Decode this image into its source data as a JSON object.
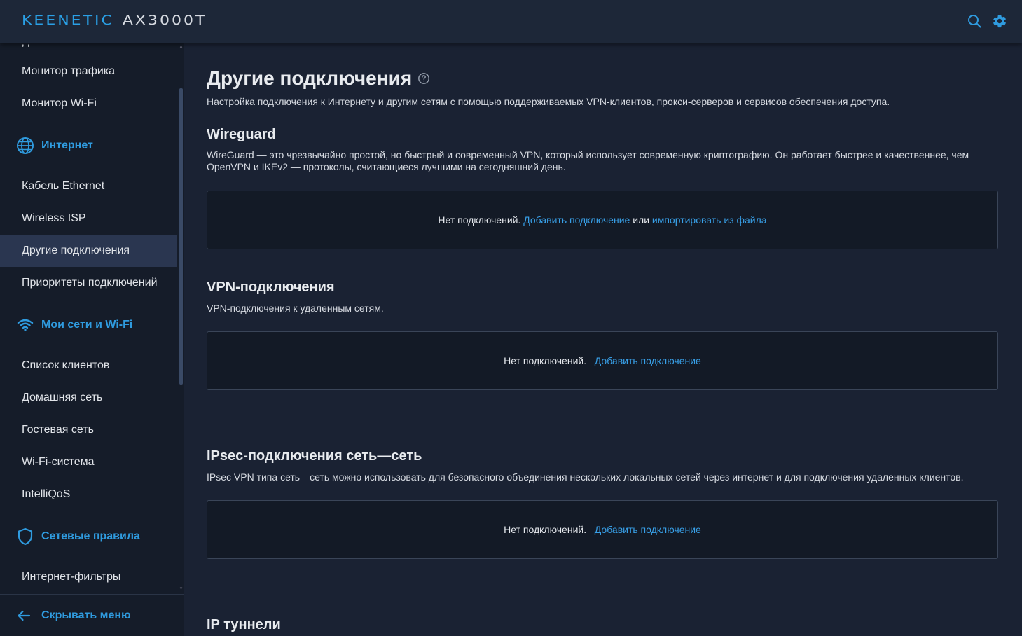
{
  "header": {
    "brand": "KEENETIC",
    "model": "AX3000T"
  },
  "colors": {
    "accent": "#2f9bdf",
    "background": "#1a2233",
    "sidebar": "#151c29",
    "active_item": "#2a3650"
  },
  "sidebar": {
    "items": [
      {
        "label": "Монитор трафика"
      },
      {
        "label": "Монитор Wi-Fi"
      },
      {
        "label": "Интернет",
        "icon": "globe-icon",
        "section": true
      },
      {
        "label": "Кабель Ethernet"
      },
      {
        "label": "Wireless ISP"
      },
      {
        "label": "Другие подключения",
        "active": true
      },
      {
        "label": "Приоритеты подключений"
      },
      {
        "label": "Мои сети и Wi-Fi",
        "icon": "wifi-icon",
        "section": true
      },
      {
        "label": "Список клиентов"
      },
      {
        "label": "Домашняя сеть"
      },
      {
        "label": "Гостевая сеть"
      },
      {
        "label": "Wi-Fi-система"
      },
      {
        "label": "IntelliQoS"
      },
      {
        "label": "Сетевые правила",
        "icon": "shield-icon",
        "section": true
      },
      {
        "label": "Интернет-фильтры"
      }
    ],
    "hide_menu": "Скрывать меню"
  },
  "main": {
    "title": "Другие подключения",
    "description": "Настройка подключения к Интернету и другим сетям с помощью поддерживаемых VPN-клиентов, прокси-серверов и сервисов обеспечения доступа.",
    "sections": [
      {
        "title": "Wireguard",
        "description": "WireGuard — это чрезвычайно простой, но быстрый и современный VPN, который использует современную криптографию. Он работает быстрее и качественнее, чем OpenVPN и IKEv2 — протоколы, считающиеся лучшими на сегодняшний день.",
        "empty_text": "Нет подключений.",
        "add_link": "Добавить подключение",
        "or_text": "или",
        "import_link": "импортировать из файла"
      },
      {
        "title": "VPN-подключения",
        "description": "VPN-подключения к удаленным сетям.",
        "empty_text": "Нет подключений.",
        "add_link": "Добавить подключение"
      },
      {
        "title": "IPsec-подключения сеть—сеть",
        "description": "IPsec VPN типа сеть—сеть можно использовать для безопасного объединения нескольких локальных сетей через интернет и для подключения удаленных клиентов.",
        "empty_text": "Нет подключений.",
        "add_link": "Добавить подключение"
      },
      {
        "title": "IP туннели"
      }
    ]
  }
}
